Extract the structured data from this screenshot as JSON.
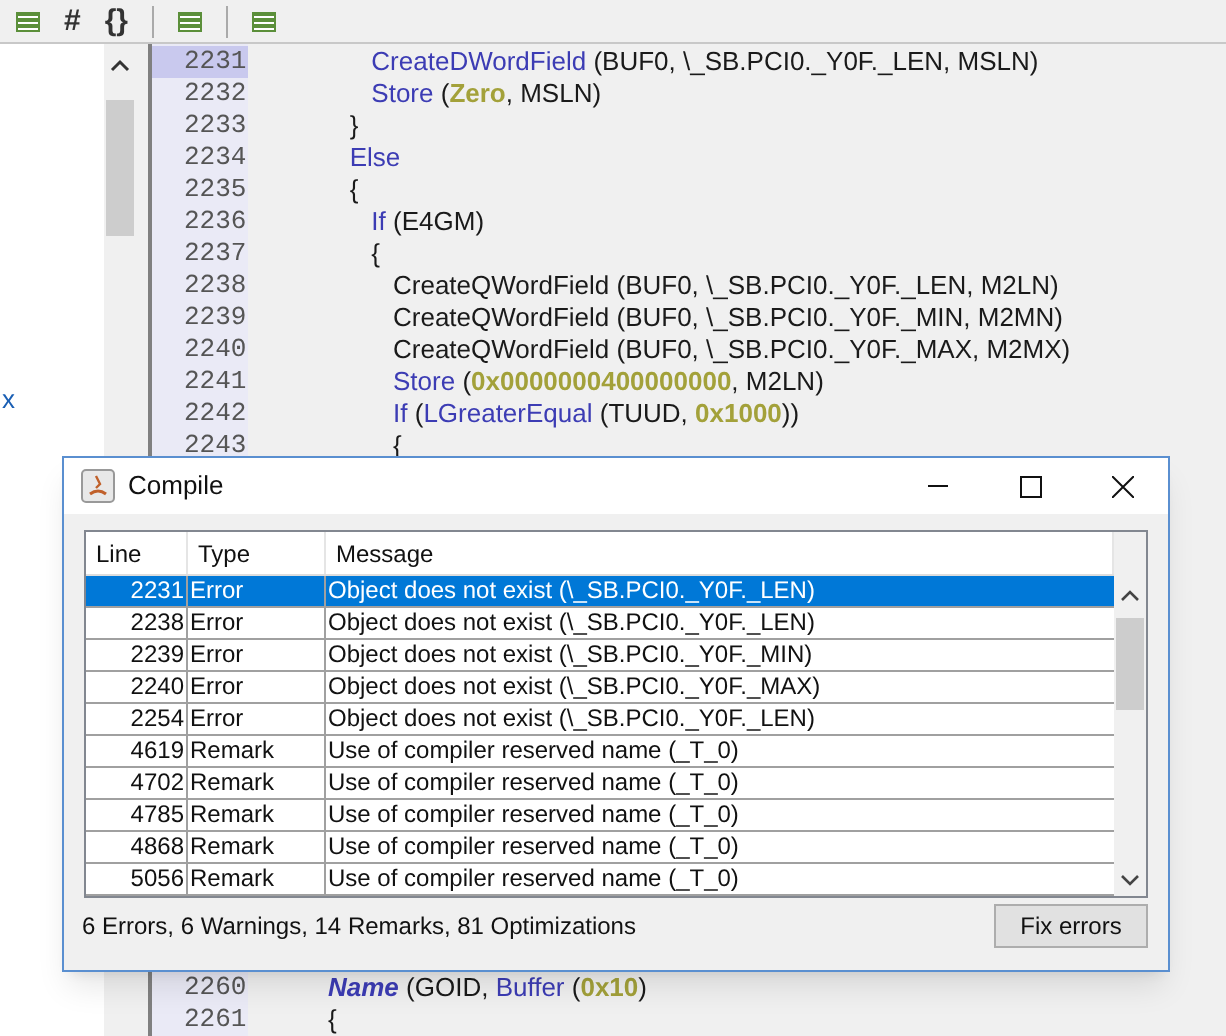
{
  "toolbar": {
    "items": [
      {
        "kind": "icon"
      },
      {
        "kind": "text",
        "label": "#"
      },
      {
        "kind": "text",
        "label": "{}"
      },
      {
        "kind": "divider"
      },
      {
        "kind": "icon"
      },
      {
        "kind": "divider"
      },
      {
        "kind": "icon"
      }
    ]
  },
  "tree": {
    "items": [
      "x"
    ]
  },
  "editor": {
    "lines_top": [
      {
        "number": "2231",
        "current": true,
        "tokens": [
          {
            "kind": "kw",
            "text": "      CreateDWordField"
          },
          {
            "kind": "plain",
            "text": " (BUF0, \\_SB.PCI0._Y0F._LEN, MSLN)"
          }
        ]
      },
      {
        "number": "2232",
        "tokens": [
          {
            "kind": "kw",
            "text": "      Store"
          },
          {
            "kind": "plain",
            "text": " ("
          },
          {
            "kind": "num",
            "text": "Zero"
          },
          {
            "kind": "plain",
            "text": ", MSLN)"
          }
        ]
      },
      {
        "number": "2233",
        "tokens": [
          {
            "kind": "plain",
            "text": "   }"
          }
        ]
      },
      {
        "number": "2234",
        "tokens": [
          {
            "kind": "kw",
            "text": "   Else"
          }
        ]
      },
      {
        "number": "2235",
        "tokens": [
          {
            "kind": "plain",
            "text": "   {"
          }
        ]
      },
      {
        "number": "2236",
        "tokens": [
          {
            "kind": "kw",
            "text": "      If"
          },
          {
            "kind": "plain",
            "text": " (E4GM)"
          }
        ]
      },
      {
        "number": "2237",
        "tokens": [
          {
            "kind": "plain",
            "text": "      {"
          }
        ]
      },
      {
        "number": "2238",
        "tokens": [
          {
            "kind": "plain",
            "text": "         CreateQWordField (BUF0, \\_SB.PCI0._Y0F._LEN, M2LN)"
          }
        ]
      },
      {
        "number": "2239",
        "tokens": [
          {
            "kind": "plain",
            "text": "         CreateQWordField (BUF0, \\_SB.PCI0._Y0F._MIN, M2MN)"
          }
        ]
      },
      {
        "number": "2240",
        "tokens": [
          {
            "kind": "plain",
            "text": "         CreateQWordField (BUF0, \\_SB.PCI0._Y0F._MAX, M2MX)"
          }
        ]
      },
      {
        "number": "2241",
        "tokens": [
          {
            "kind": "kw",
            "text": "         Store"
          },
          {
            "kind": "plain",
            "text": " ("
          },
          {
            "kind": "num",
            "text": "0x0000000400000000"
          },
          {
            "kind": "plain",
            "text": ", M2LN)"
          }
        ]
      },
      {
        "number": "2242",
        "tokens": [
          {
            "kind": "kw",
            "text": "         If"
          },
          {
            "kind": "plain",
            "text": " ("
          },
          {
            "kind": "kw",
            "text": "LGreaterEqual"
          },
          {
            "kind": "plain",
            "text": " (TUUD, "
          },
          {
            "kind": "num",
            "text": "0x1000"
          },
          {
            "kind": "plain",
            "text": "))"
          }
        ]
      },
      {
        "number": "2243",
        "tokens": [
          {
            "kind": "plain",
            "text": "         {"
          }
        ]
      }
    ],
    "lines_bottom": [
      {
        "number": "2260",
        "tokens": [
          {
            "kind": "kw_italic",
            "text": "Name"
          },
          {
            "kind": "plain",
            "text": " (GOID, "
          },
          {
            "kind": "kw",
            "text": "Buffer"
          },
          {
            "kind": "plain",
            "text": " ("
          },
          {
            "kind": "num",
            "text": "0x10"
          },
          {
            "kind": "plain",
            "text": ")"
          }
        ]
      },
      {
        "number": "2261",
        "tokens": [
          {
            "kind": "plain",
            "text": "{"
          }
        ]
      }
    ]
  },
  "dialog": {
    "title": "Compile",
    "columns": [
      "Line",
      "Type",
      "Message"
    ],
    "rows": [
      {
        "line": "2231",
        "type": "Error",
        "message": "Object does not exist (\\_SB.PCI0._Y0F._LEN)",
        "selected": true
      },
      {
        "line": "2238",
        "type": "Error",
        "message": "Object does not exist (\\_SB.PCI0._Y0F._LEN)",
        "selected": false
      },
      {
        "line": "2239",
        "type": "Error",
        "message": "Object does not exist (\\_SB.PCI0._Y0F._MIN)",
        "selected": false
      },
      {
        "line": "2240",
        "type": "Error",
        "message": "Object does not exist (\\_SB.PCI0._Y0F._MAX)",
        "selected": false
      },
      {
        "line": "2254",
        "type": "Error",
        "message": "Object does not exist (\\_SB.PCI0._Y0F._LEN)",
        "selected": false
      },
      {
        "line": "4619",
        "type": "Remark",
        "message": "Use of compiler reserved name (_T_0)",
        "selected": false
      },
      {
        "line": "4702",
        "type": "Remark",
        "message": "Use of compiler reserved name (_T_0)",
        "selected": false
      },
      {
        "line": "4785",
        "type": "Remark",
        "message": "Use of compiler reserved name (_T_0)",
        "selected": false
      },
      {
        "line": "4868",
        "type": "Remark",
        "message": "Use of compiler reserved name (_T_0)",
        "selected": false
      },
      {
        "line": "5056",
        "type": "Remark",
        "message": "Use of compiler reserved name (_T_0)",
        "selected": false
      }
    ],
    "summary": "6 Errors, 6 Warnings, 14 Remarks, 81 Optimizations",
    "button": "Fix errors"
  }
}
